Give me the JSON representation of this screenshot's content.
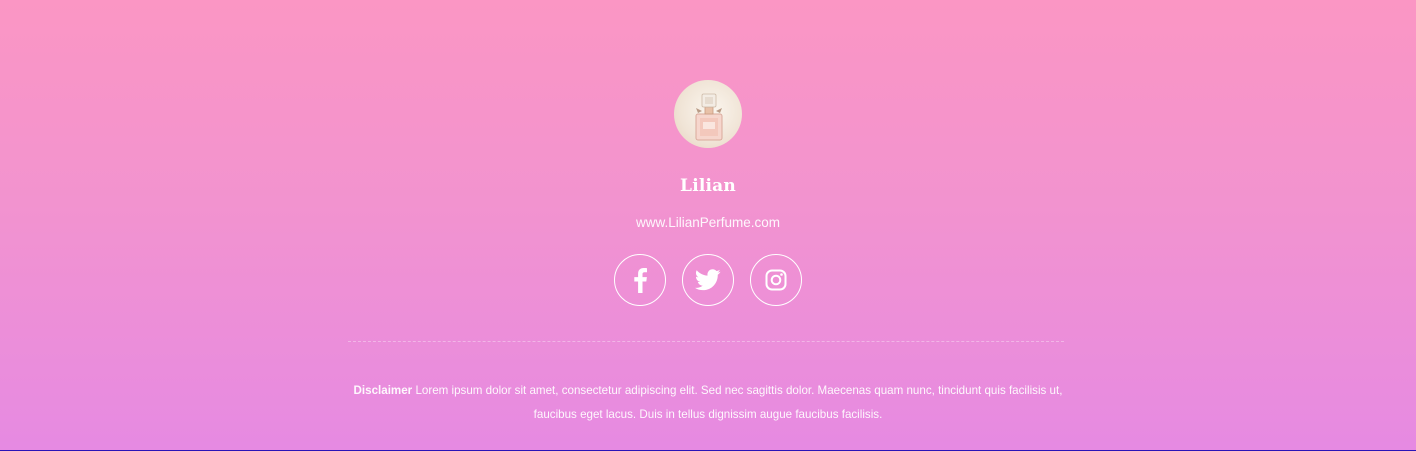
{
  "profile": {
    "name": "Lilian",
    "website": "www.LilianPerfume.com"
  },
  "socials": [
    {
      "name": "Facebook",
      "icon": "facebook-icon"
    },
    {
      "name": "Twitter",
      "icon": "twitter-icon"
    },
    {
      "name": "Instagram",
      "icon": "instagram-icon"
    }
  ],
  "disclaimer": {
    "label": "Disclaimer",
    "text": "Lorem ipsum dolor sit amet, consectetur adipiscing elit. Sed nec sagittis dolor. Maecenas quam nunc, tincidunt quis facilisis ut, faucibus eget lacus. Duis in tellus dignissim augue faucibus facilisis."
  },
  "colors": {
    "gradient_top": "#fb96c4",
    "gradient_bottom": "#e68ae2",
    "text": "#ffffff"
  }
}
